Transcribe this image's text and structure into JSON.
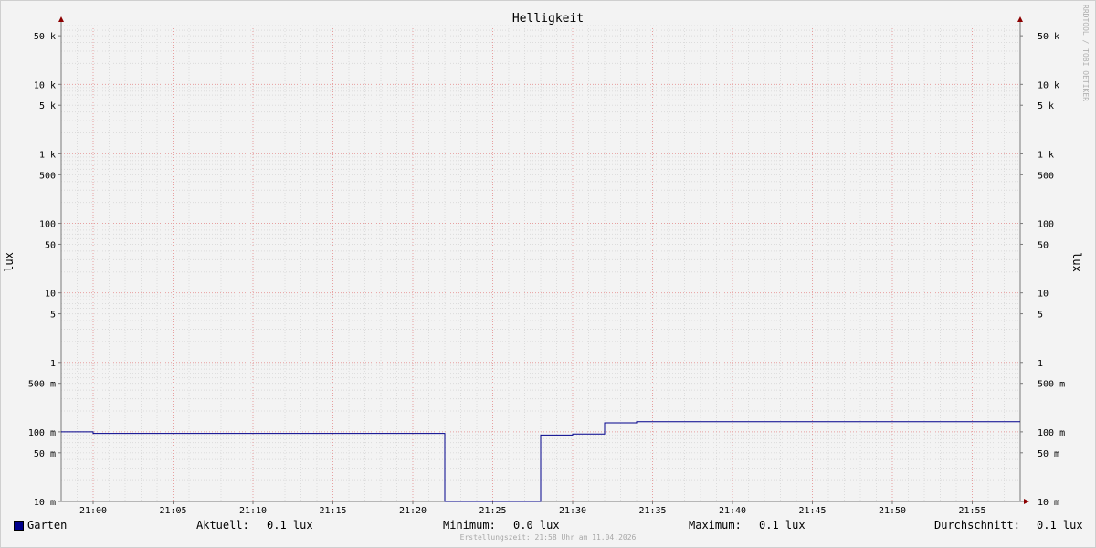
{
  "title": "Helligkeit",
  "watermark": "RRDTOOL / TOBI OETIKER",
  "footer": "Erstellungszeit: 21:58 Uhr am 11.04.2026",
  "legend": {
    "series_name": "Garten",
    "current_label": "Aktuell:",
    "current_value": "0.1 lux",
    "min_label": "Minimum:",
    "min_value": "0.0 lux",
    "max_label": "Maximum:",
    "max_value": "0.1 lux",
    "avg_label": "Durchschnitt:",
    "avg_value": "0.1 lux",
    "color": "#00008b"
  },
  "chart_data": {
    "type": "line",
    "title": "Helligkeit",
    "ylabel": "lux",
    "ylabel_right": "lux",
    "yscale": "log",
    "ylim": [
      0.01,
      70000
    ],
    "xlim": [
      "20:58",
      "21:58"
    ],
    "xticks": [
      "21:00",
      "21:05",
      "21:10",
      "21:15",
      "21:20",
      "21:25",
      "21:30",
      "21:35",
      "21:40",
      "21:45",
      "21:50",
      "21:55"
    ],
    "yticks": [
      {
        "value": 50000,
        "label": "50 k"
      },
      {
        "value": 10000,
        "label": "10 k"
      },
      {
        "value": 5000,
        "label": "5 k"
      },
      {
        "value": 1000,
        "label": "1 k"
      },
      {
        "value": 500,
        "label": "500"
      },
      {
        "value": 100,
        "label": "100"
      },
      {
        "value": 50,
        "label": "50"
      },
      {
        "value": 10,
        "label": "10"
      },
      {
        "value": 5,
        "label": "5"
      },
      {
        "value": 1,
        "label": "1"
      },
      {
        "value": 0.5,
        "label": "500 m"
      },
      {
        "value": 0.1,
        "label": "100 m"
      },
      {
        "value": 0.05,
        "label": "50 m"
      },
      {
        "value": 0.01,
        "label": "10 m"
      }
    ],
    "grid": true,
    "series": [
      {
        "name": "Garten",
        "color": "#00008b",
        "points": [
          [
            "20:58",
            0.1
          ],
          [
            "21:00",
            0.1
          ],
          [
            "21:00",
            0.095
          ],
          [
            "21:22",
            0.095
          ],
          [
            "21:22",
            0.01
          ],
          [
            "21:28",
            0.01
          ],
          [
            "21:28",
            0.09
          ],
          [
            "21:30",
            0.09
          ],
          [
            "21:30",
            0.093
          ],
          [
            "21:32",
            0.093
          ],
          [
            "21:32",
            0.135
          ],
          [
            "21:34",
            0.135
          ],
          [
            "21:34",
            0.14
          ],
          [
            "21:58",
            0.14
          ]
        ]
      }
    ]
  }
}
